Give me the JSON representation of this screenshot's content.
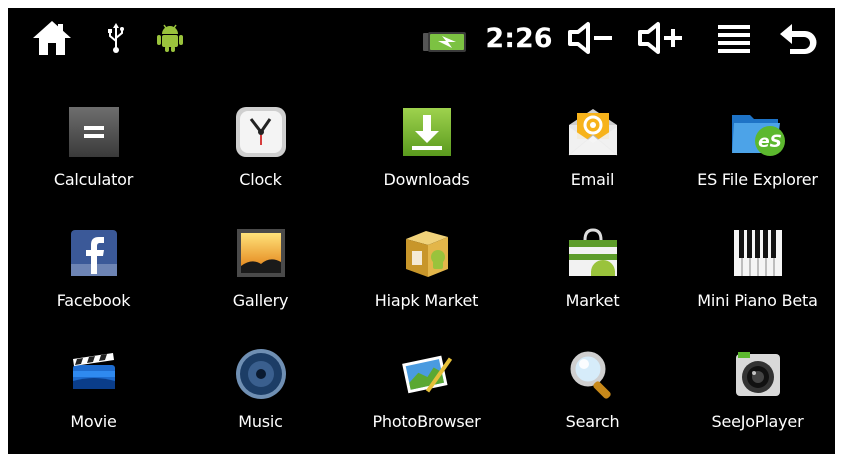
{
  "status_bar": {
    "time": "2:26",
    "icons": [
      "home-icon",
      "usb-icon",
      "android-debug-icon",
      "battery-charging-icon",
      "volume-down-icon",
      "volume-up-icon",
      "menu-icon",
      "back-icon"
    ]
  },
  "apps": [
    {
      "label": "Calculator",
      "icon": "calculator-icon"
    },
    {
      "label": "Clock",
      "icon": "clock-icon"
    },
    {
      "label": "Downloads",
      "icon": "downloads-icon"
    },
    {
      "label": "Email",
      "icon": "email-icon"
    },
    {
      "label": "ES File Explorer",
      "icon": "es-file-explorer-icon"
    },
    {
      "label": "Facebook",
      "icon": "facebook-icon"
    },
    {
      "label": "Gallery",
      "icon": "gallery-icon"
    },
    {
      "label": "Hiapk Market",
      "icon": "hiapk-market-icon"
    },
    {
      "label": "Market",
      "icon": "market-icon"
    },
    {
      "label": "Mini Piano Beta",
      "icon": "piano-icon"
    },
    {
      "label": "Movie",
      "icon": "movie-icon"
    },
    {
      "label": "Music",
      "icon": "music-icon"
    },
    {
      "label": "PhotoBrowser",
      "icon": "photobrowser-icon"
    },
    {
      "label": "Search",
      "icon": "search-icon"
    },
    {
      "label": "SeeJoPlayer",
      "icon": "seejoplayer-icon"
    }
  ],
  "colors": {
    "background": "#000000",
    "battery_green": "#7cc242",
    "android_green": "#9ac33c"
  }
}
